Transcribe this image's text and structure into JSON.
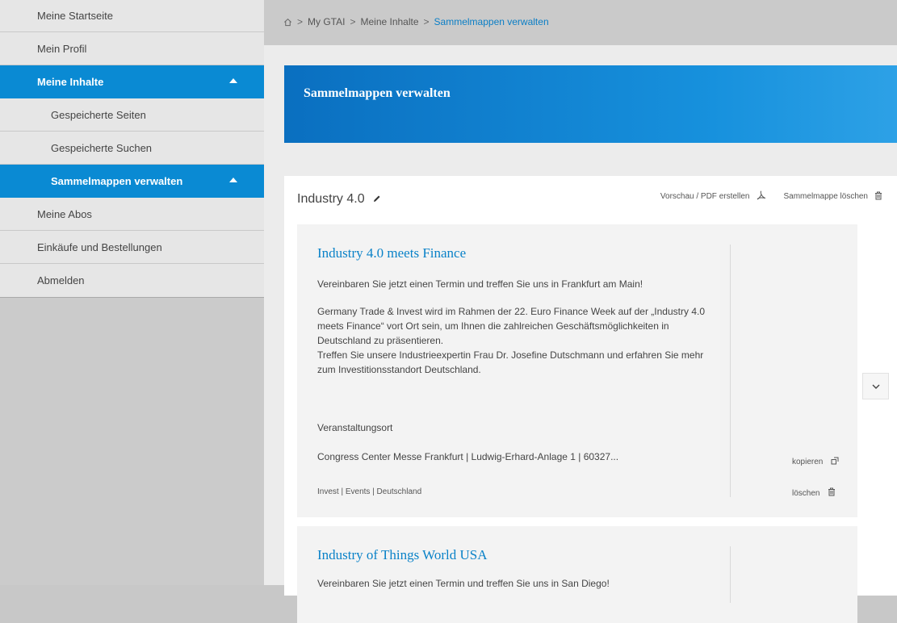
{
  "sidebar": {
    "items": [
      {
        "label": "Meine Startseite"
      },
      {
        "label": "Mein Profil"
      },
      {
        "label": "Meine Inhalte"
      },
      {
        "label": "Gespeicherte Seiten"
      },
      {
        "label": "Gespeicherte Suchen"
      },
      {
        "label": "Sammelmappen verwalten"
      },
      {
        "label": "Meine Abos"
      },
      {
        "label": "Einkäufe und Bestellungen"
      },
      {
        "label": "Abmelden"
      }
    ]
  },
  "breadcrumb": {
    "items": [
      "My GTAI",
      "Meine Inhalte",
      "Sammelmappen verwalten"
    ],
    "separator": ">"
  },
  "hero": {
    "title": "Sammelmappen verwalten"
  },
  "folder": {
    "title": "Industry 4.0",
    "preview_label": "Vorschau / PDF erstellen",
    "delete_folder_label": "Sammelmappe löschen"
  },
  "cards": [
    {
      "title": "Industry 4.0 meets Finance",
      "intro": "Vereinbaren Sie jetzt einen Termin und treffen Sie uns in Frankfurt am Main!",
      "body1": "Germany Trade & Invest wird im Rahmen der 22. Euro Finance Week auf der „Industry 4.0 meets Finance“ vort Ort sein, um Ihnen die zahlreichen Geschäftsmöglichkeiten in Deutschland zu präsentieren.",
      "body2": "Treffen Sie unsere Industrieexpertin Frau Dr. Josefine Dutschmann und erfahren Sie mehr zum Investitionsstandort Deutschland.",
      "venue_label": "Veranstaltungsort",
      "venue": "Congress Center Messe Frankfurt | Ludwig-Erhard-Anlage 1 | 60327...",
      "tags": "Invest |  Events |  Deutschland",
      "copy_label": "kopieren",
      "delete_label": "löschen"
    },
    {
      "title": "Industry of Things World USA",
      "intro": "Vereinbaren Sie jetzt einen Termin und treffen Sie uns in San Diego!"
    }
  ],
  "colors": {
    "accent": "#0a8ad3",
    "link": "#0a82c8"
  }
}
